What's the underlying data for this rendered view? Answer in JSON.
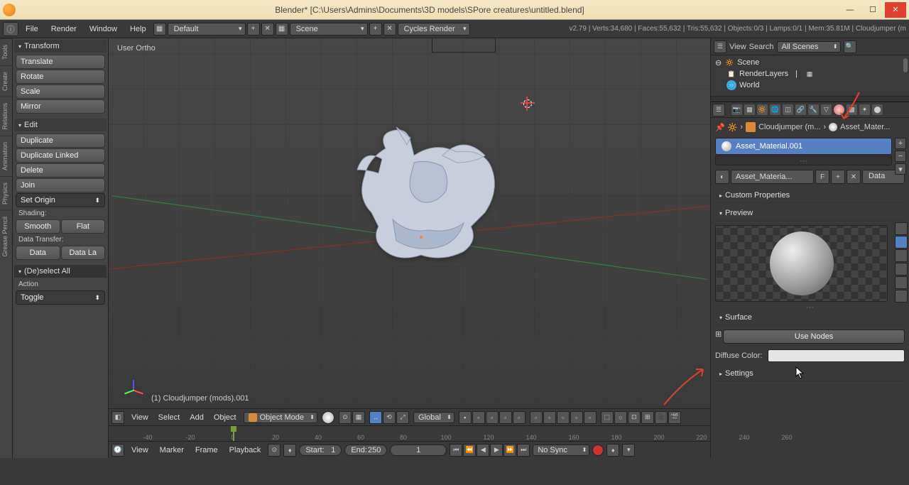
{
  "window": {
    "title": "Blender* [C:\\Users\\Admins\\Documents\\3D models\\SPore creatures\\untitled.blend]"
  },
  "topmenu": {
    "file": "File",
    "render": "Render",
    "window": "Window",
    "help": "Help",
    "layout": "Default",
    "scene": "Scene",
    "engine": "Cycles Render",
    "stats": "v2.79 | Verts:34,680 | Faces:55,632 | Tris:55,632 | Objects:0/3 | Lamps:0/1 | Mem:35.81M | Cloudjumper (m"
  },
  "toolpanel": {
    "transform_header": "Transform",
    "translate": "Translate",
    "rotate": "Rotate",
    "scale": "Scale",
    "mirror": "Mirror",
    "edit_header": "Edit",
    "duplicate": "Duplicate",
    "duplicate_linked": "Duplicate Linked",
    "delete": "Delete",
    "join": "Join",
    "set_origin": "Set Origin",
    "shading": "Shading:",
    "smooth": "Smooth",
    "flat": "Flat",
    "data_transfer": "Data Transfer:",
    "data": "Data",
    "data_la": "Data La",
    "deselect_header": "(De)select All",
    "action_label": "Action",
    "action_value": "Toggle"
  },
  "lefttabs": {
    "tools": "Tools",
    "create": "Create",
    "relations": "Relations",
    "animation": "Animation",
    "physics": "Physics",
    "grease": "Grease Pencil"
  },
  "viewport": {
    "label": "User Ortho",
    "object_name": "(1) Cloudjumper (mods).001"
  },
  "viewheader": {
    "view": "View",
    "select": "Select",
    "add": "Add",
    "object": "Object",
    "mode": "Object Mode",
    "orientation": "Global"
  },
  "outliner": {
    "view": "View",
    "search": "Search",
    "filter": "All Scenes",
    "scene": "Scene",
    "renderlayers": "RenderLayers",
    "world": "World"
  },
  "props": {
    "breadcrumb_obj": "Cloudjumper (m...",
    "breadcrumb_mat": "Asset_Mater...",
    "slot_name": "Asset_Material.001",
    "mat_name": "Asset_Materia...",
    "mat_f": "F",
    "link": "Data",
    "custom_props": "Custom Properties",
    "preview": "Preview",
    "surface": "Surface",
    "use_nodes": "Use Nodes",
    "diffuse_label": "Diffuse Color:",
    "settings": "Settings"
  },
  "timeline": {
    "ticks": [
      "-40",
      "-20",
      "0",
      "20",
      "40",
      "60",
      "80",
      "100",
      "120",
      "140",
      "160",
      "180",
      "200",
      "220",
      "240",
      "260"
    ]
  },
  "tlcontrols": {
    "view": "View",
    "marker": "Marker",
    "frame": "Frame",
    "playback": "Playback",
    "start_label": "Start:",
    "start_val": "1",
    "end_label": "End:",
    "end_val": "250",
    "current": "1",
    "sync": "No Sync"
  }
}
